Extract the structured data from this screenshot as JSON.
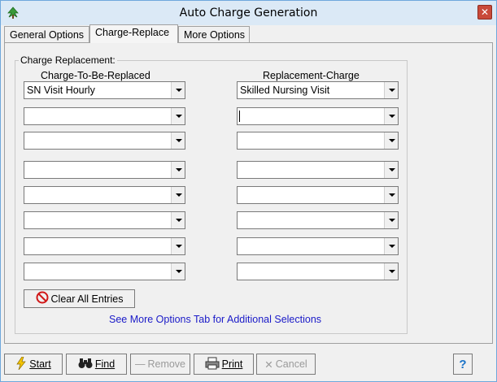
{
  "window": {
    "title": "Auto Charge Generation",
    "close_glyph": "✕"
  },
  "tabs": [
    {
      "label": "General Options"
    },
    {
      "label": "Charge-Replace"
    },
    {
      "label": "More Options"
    }
  ],
  "group": {
    "legend": "Charge Replacement:",
    "col_replaced": "Charge-To-Be-Replaced",
    "col_replacement": "Replacement-Charge",
    "rows": [
      {
        "replaced": "SN Visit Hourly",
        "replacement": "Skilled Nursing Visit"
      },
      {
        "replaced": "",
        "replacement": ""
      },
      {
        "replaced": "",
        "replacement": ""
      },
      {
        "replaced": "",
        "replacement": ""
      },
      {
        "replaced": "",
        "replacement": ""
      },
      {
        "replaced": "",
        "replacement": ""
      },
      {
        "replaced": "",
        "replacement": ""
      },
      {
        "replaced": "",
        "replacement": ""
      }
    ],
    "clear_label": "Clear All Entries",
    "hint": "See More Options Tab for Additional Selections"
  },
  "toolbar": {
    "start_label": "Start",
    "find_label": "Find",
    "remove_label": "Remove",
    "print_label": "Print",
    "cancel_label": "Cancel",
    "help_glyph": "?"
  },
  "colors": {
    "title_bg": "#dbe9f6",
    "close": "#c94a3a",
    "link": "#1a1ac8",
    "help": "#1a73c8"
  }
}
